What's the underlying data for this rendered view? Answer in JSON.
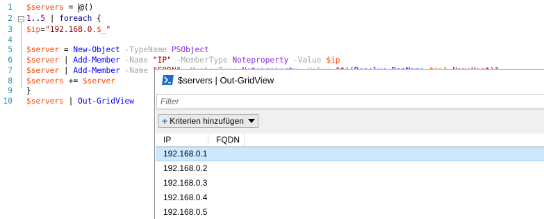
{
  "editor": {
    "lines": [
      {
        "num": "1",
        "tokens": [
          [
            "v",
            "$servers"
          ],
          [
            "p",
            " = "
          ],
          [
            "p",
            "@()"
          ]
        ]
      },
      {
        "num": "2",
        "tokens": [
          [
            "n",
            "1"
          ],
          [
            "p",
            ".."
          ],
          [
            "n",
            "5"
          ],
          [
            "p",
            " | "
          ],
          [
            "k",
            "foreach"
          ],
          [
            "p",
            " {"
          ]
        ]
      },
      {
        "num": "3",
        "tokens": [
          [
            "v",
            "$ip"
          ],
          [
            "p",
            "="
          ],
          [
            "s",
            "\"192.168.0."
          ],
          [
            "v",
            "$_"
          ],
          [
            "s",
            "\""
          ]
        ]
      },
      {
        "num": "4",
        "tokens": []
      },
      {
        "num": "5",
        "tokens": [
          [
            "v",
            "$server"
          ],
          [
            "p",
            " = "
          ],
          [
            "c",
            "New-Object"
          ],
          [
            "p",
            " "
          ],
          [
            "o",
            "-TypeName"
          ],
          [
            "p",
            " "
          ],
          [
            "m",
            "PSObject"
          ]
        ]
      },
      {
        "num": "6",
        "tokens": [
          [
            "v",
            "$server"
          ],
          [
            "p",
            " | "
          ],
          [
            "c",
            "Add-Member"
          ],
          [
            "p",
            " "
          ],
          [
            "o",
            "-Name"
          ],
          [
            "p",
            " "
          ],
          [
            "s",
            "\"IP\""
          ],
          [
            "p",
            " "
          ],
          [
            "o",
            "-MemberType"
          ],
          [
            "p",
            " "
          ],
          [
            "m",
            "Noteproperty"
          ],
          [
            "p",
            " "
          ],
          [
            "o",
            "-Value"
          ],
          [
            "p",
            " "
          ],
          [
            "v",
            "$ip"
          ]
        ]
      },
      {
        "num": "7",
        "tokens": [
          [
            "v",
            "$server"
          ],
          [
            "p",
            " | "
          ],
          [
            "c",
            "Add-Member"
          ],
          [
            "p",
            " "
          ],
          [
            "o",
            "-Name"
          ],
          [
            "p",
            " "
          ],
          [
            "s",
            "\"FQDN\""
          ],
          [
            "p",
            " "
          ],
          [
            "o",
            "-MemberType"
          ],
          [
            "p",
            " "
          ],
          [
            "m",
            "Noteproperty"
          ],
          [
            "p",
            " "
          ],
          [
            "o",
            "-Value"
          ],
          [
            "p",
            " "
          ],
          [
            "s",
            "\"$(("
          ],
          [
            "c",
            "Resolve-DnsName"
          ],
          [
            "p",
            " "
          ],
          [
            "v",
            "$ip"
          ],
          [
            "s",
            ").NameHost)\""
          ]
        ]
      },
      {
        "num": "8",
        "tokens": [
          [
            "v",
            "$servers"
          ],
          [
            "p",
            " += "
          ],
          [
            "v",
            "$server"
          ]
        ]
      },
      {
        "num": "9",
        "tokens": [
          [
            "p",
            "}"
          ]
        ]
      },
      {
        "num": "10",
        "tokens": [
          [
            "v",
            "$servers"
          ],
          [
            "p",
            " | "
          ],
          [
            "c",
            "Out-GridView"
          ]
        ]
      }
    ]
  },
  "gridview": {
    "title": "$servers | Out-GridView",
    "filter_placeholder": "Filter",
    "criteria_label": "Kriterien hinzufügen",
    "columns": [
      "IP",
      "FQDN"
    ],
    "rows": [
      {
        "ip": "192.168.0.1",
        "fqdn": ""
      },
      {
        "ip": "192.168.0.2",
        "fqdn": ""
      },
      {
        "ip": "192.168.0.3",
        "fqdn": ""
      },
      {
        "ip": "192.168.0.4",
        "fqdn": ""
      },
      {
        "ip": "192.168.0.5",
        "fqdn": ""
      }
    ],
    "selected_row": 0
  },
  "colors": {
    "variable": "#ff4500",
    "string": "#8b0000",
    "number": "#800080",
    "command": "#0000ff",
    "parameter": "#a9a9a9",
    "type": "#8a2be2",
    "line_number": "#2b91af",
    "selection": "#cce8ff"
  },
  "icons": {
    "window": "powershell-icon",
    "criteria": "plus-icon",
    "dropdown": "triangle-down-icon"
  }
}
